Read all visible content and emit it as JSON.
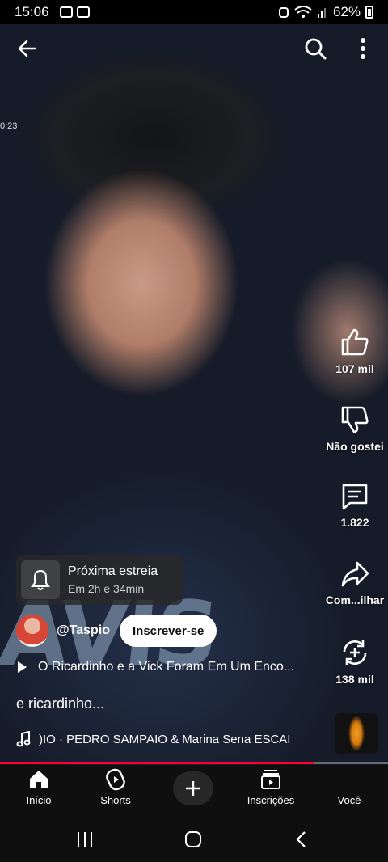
{
  "status_bar": {
    "time": "15:06",
    "battery": "62%"
  },
  "video": {
    "timestamp_fragment": "0:23",
    "shirt_text": "AVIS"
  },
  "top_bar": {
    "back_icon": "arrow-left-icon",
    "search_icon": "search-icon",
    "more_icon": "more-vertical-icon"
  },
  "actions": {
    "like_label": "107 mil",
    "dislike_label": "Não gostei",
    "comments_label": "1.822",
    "share_label": "Com...ilhar",
    "remix_label": "138 mil"
  },
  "premiere": {
    "title": "Próxima estreia",
    "subtitle": "Em 2h e 34min"
  },
  "channel": {
    "name": "@Taspio",
    "subscribe_label": "Inscrever-se"
  },
  "playlist_title": "O Ricardinho e a Vick Foram Em Um Enco...",
  "caption": "e ricardinho...",
  "music": {
    "track": ")IO · PEDRO SAMPAIO & Marina Sena    ESCAI"
  },
  "progress": 0.81,
  "nav": {
    "home": "Início",
    "shorts": "Shorts",
    "subscriptions": "Inscrições",
    "you": "Você"
  },
  "colors": {
    "accent": "#ff0033",
    "nav_bg": "#0f0f0f"
  }
}
